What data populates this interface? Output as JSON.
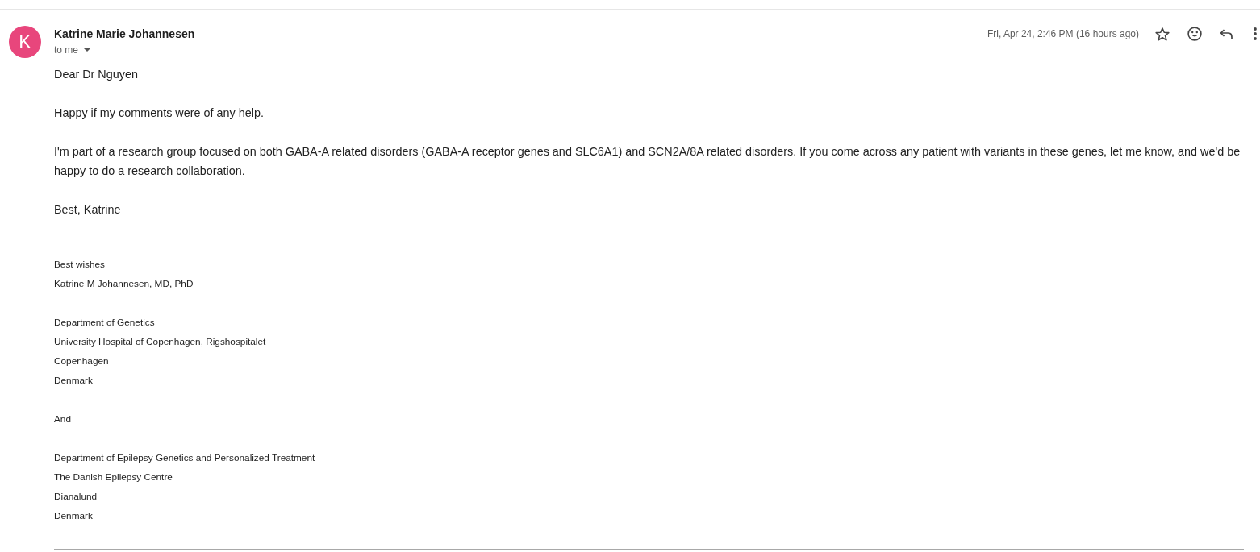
{
  "email": {
    "sender": {
      "name": "Katrine Marie Johannesen",
      "initial": "K"
    },
    "recipients": "to me",
    "date": "Fri, Apr 24, 2:46 PM (16 hours ago)",
    "starred": false,
    "body": [
      "Dear Dr Nguyen",
      "Happy if my comments were of any help.",
      "I'm part of a research group focused on both GABA-A related disorders (GABA-A receptor genes and SLC6A1) and SCN2A/8A related disorders. If you come across any patient with variants in these genes, let me know, and we'd be happy to do a research collaboration.",
      "Best, Katrine"
    ],
    "signature": [
      [
        "Best wishes",
        "Katrine M Johannesen, MD, PhD"
      ],
      [
        "Department of Genetics",
        "University Hospital of Copenhagen, Rigshospitalet",
        "Copenhagen",
        "Denmark"
      ],
      [
        "And"
      ],
      [
        "Department of Epilepsy Genetics and Personalized Treatment",
        "The Danish Epilepsy Centre",
        "Dianalund",
        "Denmark"
      ]
    ]
  }
}
